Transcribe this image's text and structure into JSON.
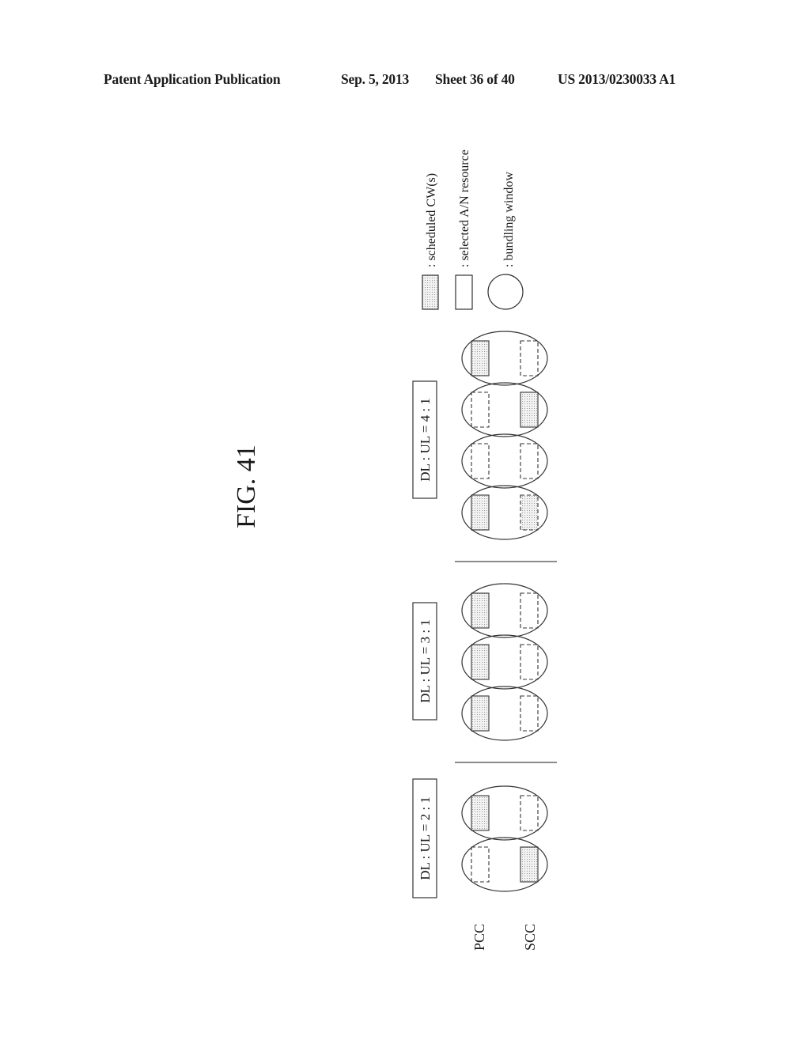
{
  "header": {
    "publication": "Patent Application Publication",
    "date": "Sep. 5, 2013",
    "sheet": "Sheet 36 of 40",
    "number": "US 2013/0230033 A1"
  },
  "figure": {
    "title": "FIG. 41",
    "row_labels": {
      "pcc": "PCC",
      "scc": "SCC"
    },
    "legend": [
      {
        "symbol": "shaded-rect-icon",
        "label": ": scheduled CW(s)"
      },
      {
        "symbol": "solid-rect-icon",
        "label": ": selected A/N resource"
      },
      {
        "symbol": "circle-icon",
        "label": ": bundling window"
      }
    ],
    "groups": [
      {
        "label": "DL : UL = 4 : 1",
        "windows": [
          {
            "pcc": {
              "scheduled": true,
              "selected": true
            },
            "scc": {
              "scheduled": false,
              "selected": false
            }
          },
          {
            "pcc": {
              "scheduled": false,
              "selected": false
            },
            "scc": {
              "scheduled": true,
              "selected": true
            }
          },
          {
            "pcc": {
              "scheduled": false,
              "selected": false
            },
            "scc": {
              "scheduled": false,
              "selected": false
            }
          },
          {
            "pcc": {
              "scheduled": true,
              "selected": true
            },
            "scc": {
              "scheduled": true,
              "selected": false
            }
          }
        ]
      },
      {
        "label": "DL : UL = 3 : 1",
        "windows": [
          {
            "pcc": {
              "scheduled": true,
              "selected": true
            },
            "scc": {
              "scheduled": false,
              "selected": false
            }
          },
          {
            "pcc": {
              "scheduled": true,
              "selected": true
            },
            "scc": {
              "scheduled": false,
              "selected": false
            }
          },
          {
            "pcc": {
              "scheduled": true,
              "selected": true
            },
            "scc": {
              "scheduled": false,
              "selected": false
            }
          }
        ]
      },
      {
        "label": "DL : UL = 2 : 1",
        "windows": [
          {
            "pcc": {
              "scheduled": true,
              "selected": true
            },
            "scc": {
              "scheduled": false,
              "selected": false
            }
          },
          {
            "pcc": {
              "scheduled": false,
              "selected": false
            },
            "scc": {
              "scheduled": true,
              "selected": true
            }
          }
        ]
      }
    ]
  }
}
